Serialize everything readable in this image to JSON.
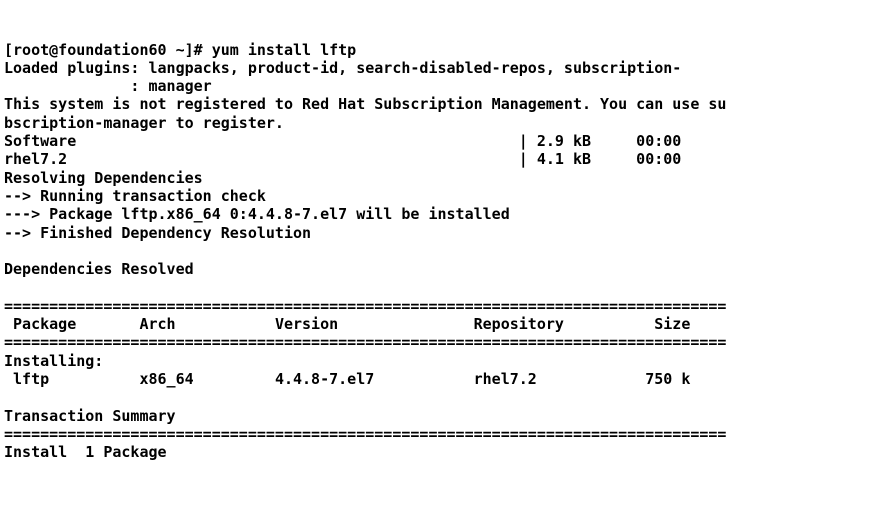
{
  "prompt": {
    "prefix": "[root@foundation60 ~]#",
    "command": "yum install lftp"
  },
  "plugins": {
    "line1": "Loaded plugins: langpacks, product-id, search-disabled-repos, subscription-",
    "line2": "              : manager"
  },
  "registration": {
    "line1": "This system is not registered to Red Hat Subscription Management. You can use su",
    "line2": "bscription-manager to register."
  },
  "repos": {
    "r0": {
      "name": "Software",
      "size": "| 2.9 kB",
      "time": "00:00"
    },
    "r1": {
      "name": "rhel7.2",
      "size": "| 4.1 kB",
      "time": "00:00"
    }
  },
  "resolving": {
    "header": "Resolving Dependencies",
    "l1": "--> Running transaction check",
    "l2": "---> Package lftp.x86_64 0:4.4.8-7.el7 will be installed",
    "l3": "--> Finished Dependency Resolution"
  },
  "deps_resolved": "Dependencies Resolved",
  "hr": "================================================================================",
  "table": {
    "hdr": {
      "c0": "Package",
      "c1": "Arch",
      "c2": "Version",
      "c3": "Repository",
      "c4": "Size"
    },
    "installing": "Installing:",
    "row": {
      "c0": "lftp",
      "c1": "x86_64",
      "c2": "4.4.8-7.el7",
      "c3": "rhel7.2",
      "c4": "750 k"
    }
  },
  "txn_summary": "Transaction Summary",
  "install_line": "Install  1 Package"
}
